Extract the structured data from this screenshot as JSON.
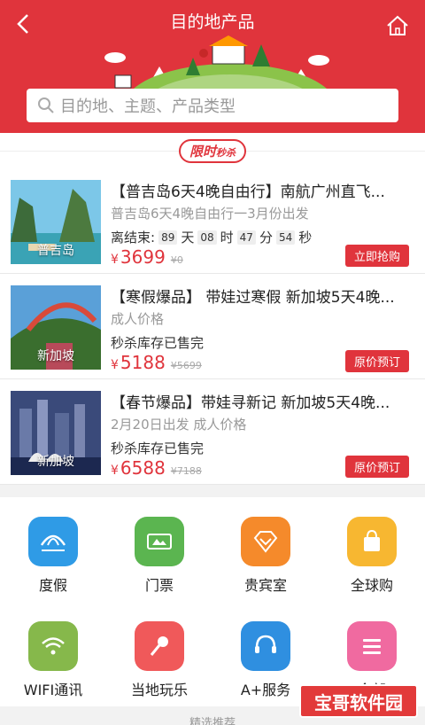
{
  "header": {
    "title": "目的地产品"
  },
  "search": {
    "placeholder": "目的地、主题、产品类型"
  },
  "flash_sale": {
    "badge_main": "限时",
    "badge_small": "秒杀"
  },
  "products": [
    {
      "thumb_label": "普吉岛",
      "title": "【普吉岛6天4晚自由行】南航广州直飞...",
      "subtitle": "普吉岛6天4晚自由行一3月份出发",
      "countdown": {
        "prefix": "离结束:",
        "days": "89",
        "d_unit": "天",
        "hours": "08",
        "h_unit": "时",
        "minutes": "47",
        "m_unit": "分",
        "seconds": "54",
        "s_unit": "秒"
      },
      "status": "",
      "currency": "¥",
      "price": "3699",
      "orig_price": "¥0",
      "button": "立即抢购"
    },
    {
      "thumb_label": "新加坡",
      "title": "【寒假爆品】 带娃过寒假 新加坡5天4晚...",
      "subtitle": "成人价格",
      "status": "秒杀库存已售完",
      "currency": "¥",
      "price": "5188",
      "orig_price": "¥5699",
      "button": "原价预订"
    },
    {
      "thumb_label": "新加坡",
      "title": "【春节爆品】带娃寻新记 新加坡5天4晚...",
      "subtitle": "2月20日出发 成人价格",
      "status": "秒杀库存已售完",
      "currency": "¥",
      "price": "6588",
      "orig_price": "¥7188",
      "button": "原价预订"
    }
  ],
  "categories": [
    {
      "label": "度假",
      "icon": "umbrella-icon",
      "color": "#2f9be6"
    },
    {
      "label": "门票",
      "icon": "ticket-icon",
      "color": "#5bb550"
    },
    {
      "label": "贵宾室",
      "icon": "diamond-icon",
      "color": "#f58a2b"
    },
    {
      "label": "全球购",
      "icon": "bag-icon",
      "color": "#f7b731"
    },
    {
      "label": "WIFI通讯",
      "icon": "wifi-icon",
      "color": "#86b84b"
    },
    {
      "label": "当地玩乐",
      "icon": "microphone-icon",
      "color": "#f0595a"
    },
    {
      "label": "A+服务",
      "icon": "headset-icon",
      "color": "#2f8fe0"
    },
    {
      "label": "全部",
      "icon": "menu-icon",
      "color": "#f06aa0"
    }
  ],
  "footer": {
    "more": "精选推荐"
  },
  "watermark": "宝哥软件园"
}
